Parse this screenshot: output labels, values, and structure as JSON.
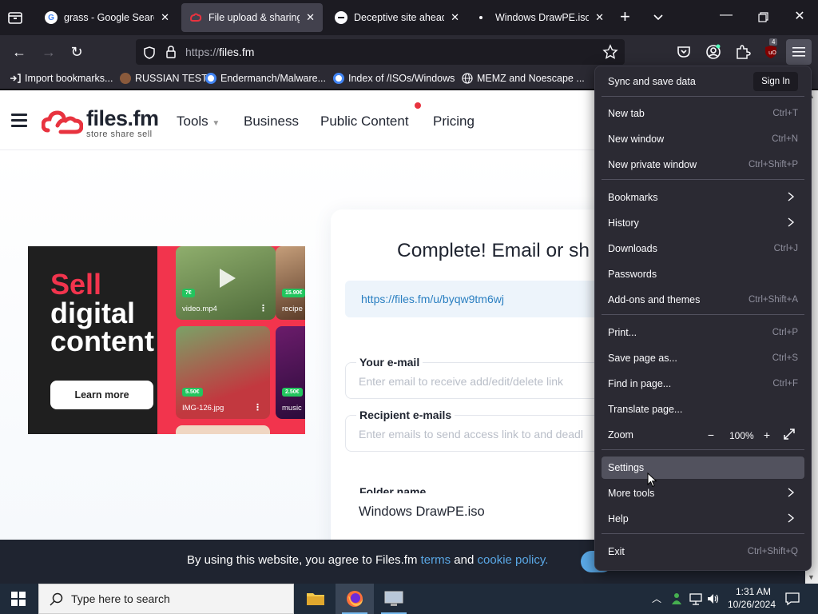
{
  "tabs": [
    {
      "title": "grass - Google Search",
      "favicon": "google-icon"
    },
    {
      "title": "File upload & sharing. F",
      "favicon": "filesfm-icon"
    },
    {
      "title": "Deceptive site ahead",
      "favicon": "warning-icon"
    },
    {
      "title": "Windows DrawPE.iso | F",
      "favicon": "dot-icon"
    }
  ],
  "navbar": {
    "url_scheme": "https://",
    "url_host": "files.fm",
    "extension_badge": "4"
  },
  "bookmarks": [
    {
      "label": "Import bookmarks...",
      "icon": "import-icon"
    },
    {
      "label": "RUSSIAN TEST",
      "icon": "mask-icon"
    },
    {
      "label": "Endermanch/Malware...",
      "icon": "google-icon"
    },
    {
      "label": "Index of /ISOs/Windows",
      "icon": "google-icon"
    },
    {
      "label": "MEMZ and Noescape ...",
      "icon": "globe-icon"
    }
  ],
  "site": {
    "logo_text": "files.fm",
    "logo_sub": "store  share  sell",
    "nav": [
      "Tools",
      "Business",
      "Public Content",
      "Pricing"
    ]
  },
  "ad": {
    "line1": "Sell",
    "line2": "digital",
    "line3": "content",
    "button": "Learn more",
    "cards": [
      {
        "label": "video.mp4",
        "price": "7€"
      },
      {
        "label": "recipe",
        "price": "15.90€"
      },
      {
        "label": "IMG-126.jpg",
        "price": "5.50€"
      },
      {
        "label": "music",
        "price": "2.50€"
      }
    ]
  },
  "upload": {
    "title": "Complete! Email or sh",
    "link": "https://files.fm/u/byqw9tm6wj",
    "email_label": "Your e-mail",
    "email_placeholder": "Enter email to receive add/edit/delete link",
    "recipients_label": "Recipient e-mails",
    "recipients_placeholder": "Enter emails to send access link to and deadl",
    "folder_label": "Folder name",
    "folder_value": "Windows DrawPE.iso"
  },
  "cookie": {
    "text_before": "By using this website, you agree to Files.fm ",
    "terms": "terms",
    "and": " and ",
    "policy": "cookie policy."
  },
  "menu": {
    "sync_label": "Sync and save data",
    "signin": "Sign In",
    "items": [
      {
        "label": "New tab",
        "shortcut": "Ctrl+T"
      },
      {
        "label": "New window",
        "shortcut": "Ctrl+N"
      },
      {
        "label": "New private window",
        "shortcut": "Ctrl+Shift+P"
      },
      {
        "label": "Bookmarks",
        "shortcut": ""
      },
      {
        "label": "History",
        "shortcut": ""
      },
      {
        "label": "Downloads",
        "shortcut": "Ctrl+J"
      },
      {
        "label": "Passwords",
        "shortcut": ""
      },
      {
        "label": "Add-ons and themes",
        "shortcut": "Ctrl+Shift+A"
      },
      {
        "label": "Print...",
        "shortcut": "Ctrl+P"
      },
      {
        "label": "Save page as...",
        "shortcut": "Ctrl+S"
      },
      {
        "label": "Find in page...",
        "shortcut": "Ctrl+F"
      },
      {
        "label": "Translate page...",
        "shortcut": ""
      },
      {
        "label": "Zoom",
        "shortcut": ""
      },
      {
        "label": "Settings",
        "shortcut": ""
      },
      {
        "label": "More tools",
        "shortcut": ""
      },
      {
        "label": "Help",
        "shortcut": ""
      },
      {
        "label": "Exit",
        "shortcut": "Ctrl+Shift+Q"
      }
    ],
    "zoom_value": "100%"
  },
  "taskbar": {
    "search_placeholder": "Type here to search",
    "time": "1:31 AM",
    "date": "10/26/2024"
  },
  "colors": {
    "accent_red": "#f2344d",
    "link_blue": "#2a7fc1",
    "menu_bg": "#2b2a33",
    "tab_bg": "#1c1b22"
  }
}
